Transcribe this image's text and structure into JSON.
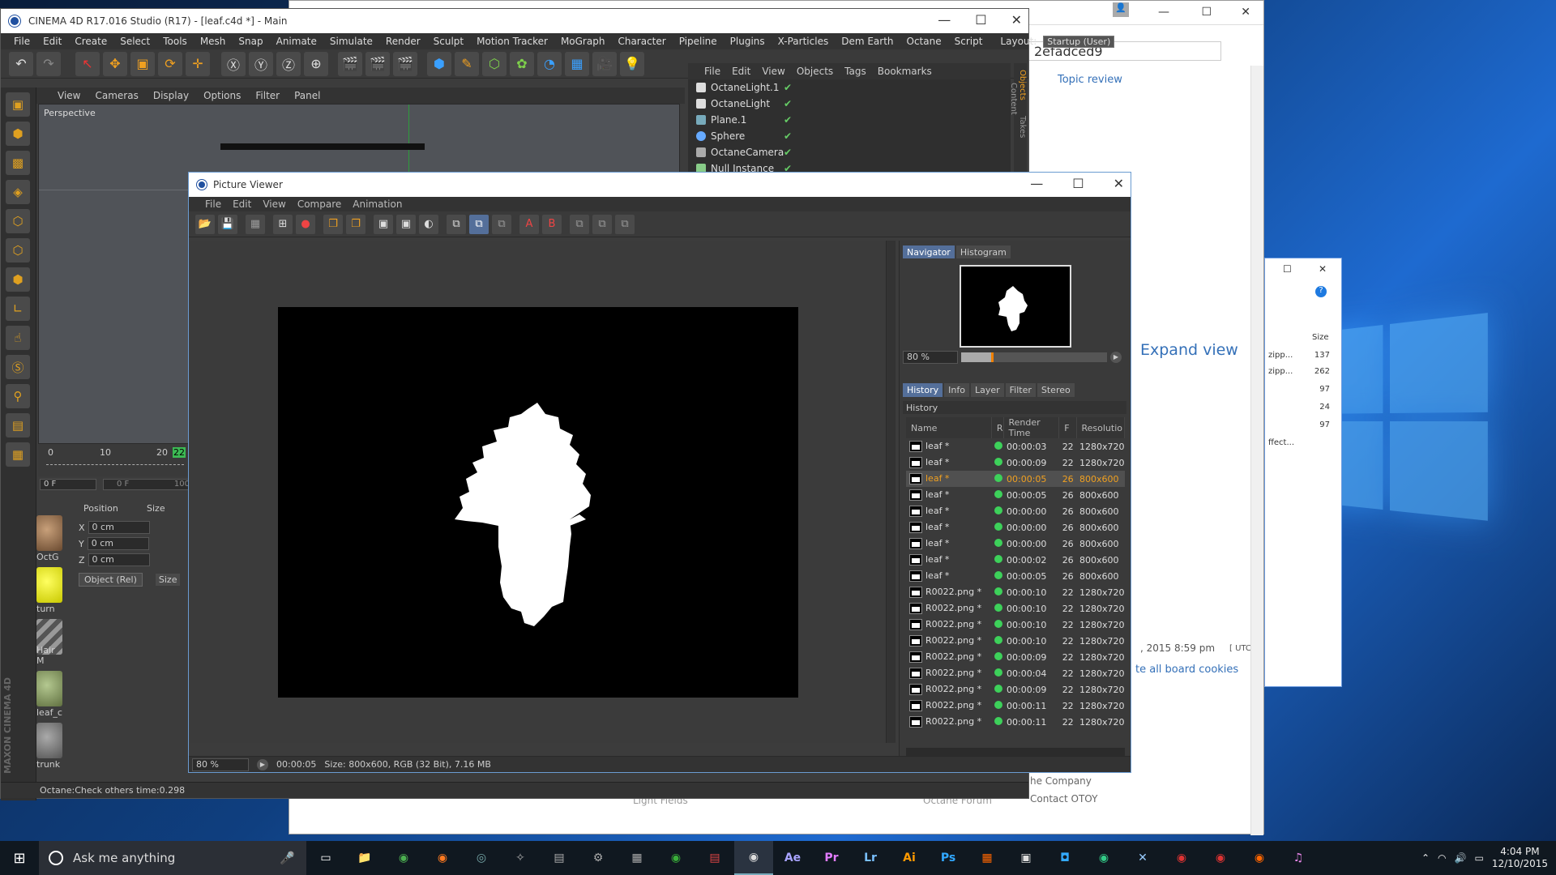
{
  "c4d": {
    "title": "CINEMA 4D R17.016 Studio (R17) - [leaf.c4d *] - Main",
    "menu": [
      "File",
      "Edit",
      "Create",
      "Select",
      "Tools",
      "Mesh",
      "Snap",
      "Animate",
      "Simulate",
      "Render",
      "Sculpt",
      "Motion Tracker",
      "MoGraph",
      "Character",
      "Pipeline",
      "Plugins",
      "X-Particles",
      "Dem Earth",
      "Octane",
      "Script"
    ],
    "layout_label": "Layout:",
    "layout_value": "Startup (User)",
    "viewport_menu": [
      "View",
      "Cameras",
      "Display",
      "Options",
      "Filter",
      "Panel"
    ],
    "viewport_label": "Perspective",
    "timeline": {
      "ticks": [
        "0",
        "10",
        "20",
        "22"
      ],
      "frame": "0 F",
      "end_frame": "0 F",
      "end": "100"
    },
    "object_manager": {
      "menu": [
        "File",
        "Edit",
        "View",
        "Objects",
        "Tags",
        "Bookmarks"
      ],
      "objects": [
        "OctaneLight.1",
        "OctaneLight",
        "Plane.1",
        "Sphere",
        "OctaneCamera",
        "Null Instance"
      ]
    },
    "side_tabs": [
      "Objects",
      "Takes",
      "Content"
    ],
    "coords": {
      "header_pos": "Position",
      "header_size": "Size",
      "x": "0 cm",
      "y": "0 cm",
      "z": "0 cm",
      "mode": "Object (Rel)",
      "size_btn": "Size"
    },
    "materials": [
      "OctG",
      "turn",
      "Hair M",
      "leaf_c",
      "trunk"
    ],
    "status": "Octane:Check others time:0.298",
    "brand": "MAXON CINEMA 4D"
  },
  "pv": {
    "title": "Picture Viewer",
    "menu": [
      "File",
      "Edit",
      "View",
      "Compare",
      "Animation"
    ],
    "tabs_top": [
      "Navigator",
      "Histogram"
    ],
    "zoom": "80 %",
    "tabs_bottom": [
      "History",
      "Info",
      "Layer",
      "Filter",
      "Stereo"
    ],
    "history_label": "History",
    "columns": [
      "Name",
      "R",
      "Render Time",
      "F",
      "Resolutio"
    ],
    "rows": [
      {
        "name": "leaf *",
        "time": "00:00:03",
        "f": "22",
        "res": "1280x720"
      },
      {
        "name": "leaf *",
        "time": "00:00:09",
        "f": "22",
        "res": "1280x720"
      },
      {
        "name": "leaf *",
        "time": "00:00:05",
        "f": "26",
        "res": "800x600"
      },
      {
        "name": "leaf *",
        "time": "00:00:05",
        "f": "26",
        "res": "800x600"
      },
      {
        "name": "leaf *",
        "time": "00:00:00",
        "f": "26",
        "res": "800x600"
      },
      {
        "name": "leaf *",
        "time": "00:00:00",
        "f": "26",
        "res": "800x600"
      },
      {
        "name": "leaf *",
        "time": "00:00:00",
        "f": "26",
        "res": "800x600"
      },
      {
        "name": "leaf *",
        "time": "00:00:02",
        "f": "26",
        "res": "800x600"
      },
      {
        "name": "leaf *",
        "time": "00:00:05",
        "f": "26",
        "res": "800x600"
      },
      {
        "name": "R0022.png *",
        "time": "00:00:10",
        "f": "22",
        "res": "1280x720"
      },
      {
        "name": "R0022.png *",
        "time": "00:00:10",
        "f": "22",
        "res": "1280x720"
      },
      {
        "name": "R0022.png *",
        "time": "00:00:10",
        "f": "22",
        "res": "1280x720"
      },
      {
        "name": "R0022.png *",
        "time": "00:00:10",
        "f": "22",
        "res": "1280x720"
      },
      {
        "name": "R0022.png *",
        "time": "00:00:09",
        "f": "22",
        "res": "1280x720"
      },
      {
        "name": "R0022.png *",
        "time": "00:00:04",
        "f": "22",
        "res": "1280x720"
      },
      {
        "name": "R0022.png *",
        "time": "00:00:09",
        "f": "22",
        "res": "1280x720"
      },
      {
        "name": "R0022.png *",
        "time": "00:00:11",
        "f": "22",
        "res": "1280x720"
      },
      {
        "name": "R0022.png *",
        "time": "00:00:11",
        "f": "22",
        "res": "1280x720"
      }
    ],
    "selected_row": 2,
    "status": {
      "zoom": "80 %",
      "time": "00:00:05",
      "info": "Size: 800x600, RGB (32 Bit), 7.16 MB"
    }
  },
  "browser": {
    "address": "2efadced9",
    "topic_review": "Topic review",
    "expand_view": "Expand view",
    "timestamp": ", 2015 8:59 pm",
    "utc": "[ UTC ]",
    "cookies": "te all board cookies",
    "company": "he Company",
    "contact": "Contact OTOY",
    "footer1": "Light Fields",
    "footer2": "Octane Forum"
  },
  "explorer": {
    "size_header": "Size",
    "items": [
      {
        "name": "zipp...",
        "size": "137"
      },
      {
        "name": "zipp...",
        "size": "262"
      },
      {
        "name": "",
        "size": "97"
      },
      {
        "name": "",
        "size": "24"
      },
      {
        "name": "",
        "size": "97"
      },
      {
        "name": "ffect...",
        "size": ""
      }
    ]
  },
  "taskbar": {
    "search_placeholder": "Ask me anything",
    "apps": [
      "Ae",
      "Pr",
      "Lr",
      "Ai",
      "Ps"
    ],
    "time": "4:04 PM",
    "date": "12/10/2015"
  },
  "colors": {
    "accent": "#f0a020",
    "selection": "#546f9a",
    "desktop": "#0f3f80"
  }
}
